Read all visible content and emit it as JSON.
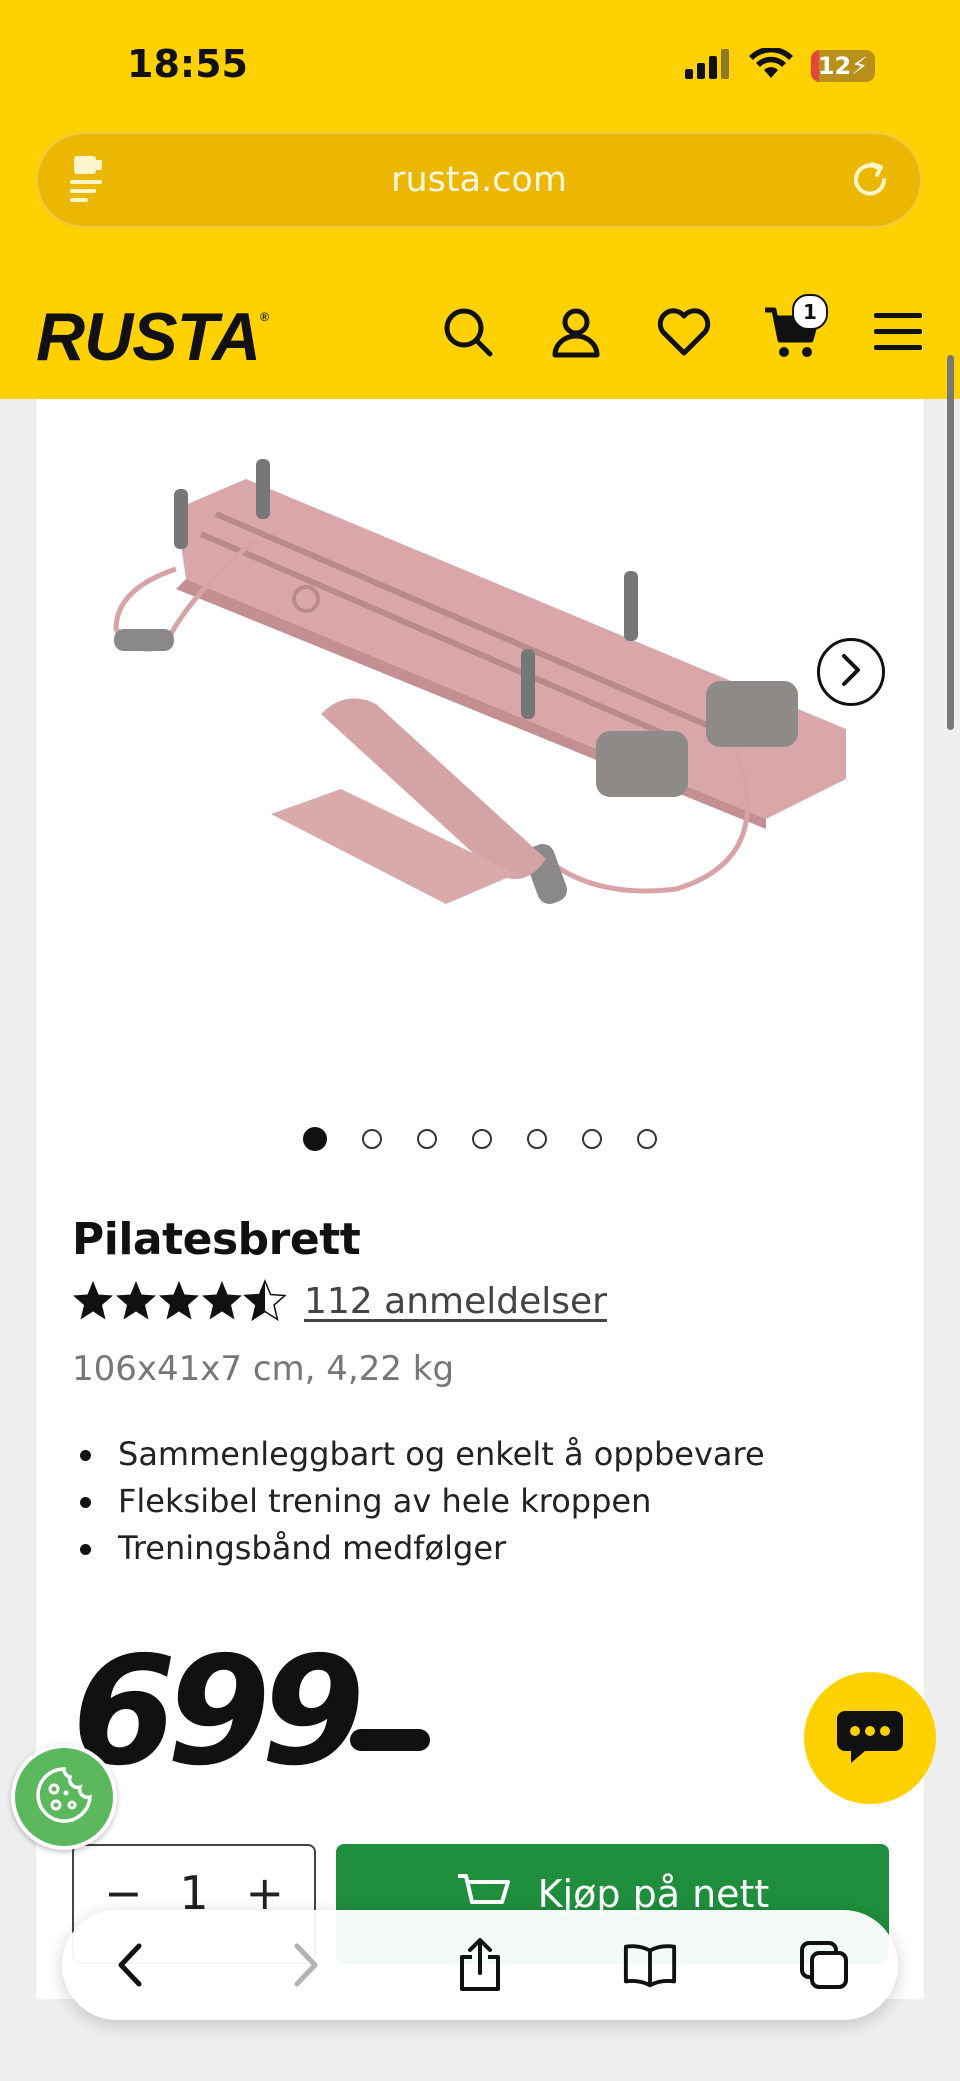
{
  "status_bar": {
    "time": "18:55",
    "battery_level": "12",
    "icons": [
      "cellular-signal-icon",
      "wifi-icon",
      "battery-charging-icon"
    ]
  },
  "browser": {
    "url": "rusta.com",
    "icons": [
      "reader-menu-icon",
      "reload-icon"
    ]
  },
  "header": {
    "logo": "RUSTA",
    "logo_mark": "®",
    "cart_count": "1",
    "icons": [
      "search-icon",
      "account-icon",
      "heart-icon",
      "cart-icon",
      "menu-icon"
    ]
  },
  "gallery": {
    "image_count": 7,
    "active_index": 0,
    "next_icon": "chevron-right-icon"
  },
  "product": {
    "title": "Pilatesbrett",
    "rating_stars": 4.5,
    "reviews": "112 anmeldelser",
    "dimensions": "106x41x7 cm, 4,22 kg",
    "bullets": [
      "Sammenleggbart og enkelt å oppbevare",
      "Fleksibel trening av hele kroppen",
      "Treningsbånd medfølger"
    ],
    "price": "699"
  },
  "purchase": {
    "minus": "−",
    "quantity": "1",
    "plus": "+",
    "buy_label": "Kjøp på nett"
  },
  "floating": {
    "chat_icon": "chat-bubble-icon",
    "cookie_icon": "cookie-icon"
  },
  "browser_toolbar": {
    "icons": [
      "back-icon",
      "forward-icon",
      "share-icon",
      "bookmarks-icon",
      "tabs-icon"
    ]
  },
  "colors": {
    "brand_yellow": "#ffd100",
    "buy_green": "#1f8f3d",
    "cookie_green": "#5cb85c"
  }
}
